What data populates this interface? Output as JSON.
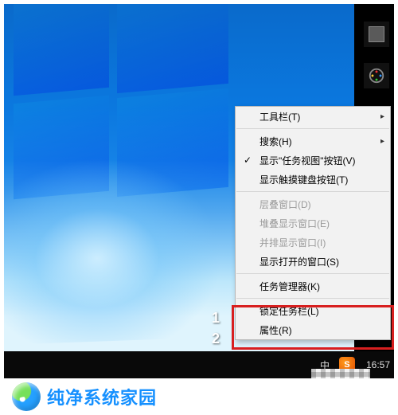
{
  "menu": {
    "toolbars": {
      "label": "工具栏(T)"
    },
    "search": {
      "label": "搜索(H)"
    },
    "taskview": {
      "label": "显示\"任务视图\"按钮(V)"
    },
    "touchkb": {
      "label": "显示触摸键盘按钮(T)"
    },
    "cascade": {
      "label": "层叠窗口(D)"
    },
    "stack": {
      "label": "堆叠显示窗口(E)"
    },
    "sidebyside": {
      "label": "并排显示窗口(I)"
    },
    "showdesk": {
      "label": "显示打开的窗口(S)"
    },
    "taskmgr": {
      "label": "任务管理器(K)"
    },
    "lock": {
      "label": "锁定任务栏(L)"
    },
    "props": {
      "label": "属性(R)"
    }
  },
  "annotations": {
    "one": "1",
    "two": "2"
  },
  "taskbar": {
    "ime": "中",
    "clock": "16:57",
    "sogou": "S"
  },
  "footer": {
    "brand": "纯净系统家园"
  }
}
